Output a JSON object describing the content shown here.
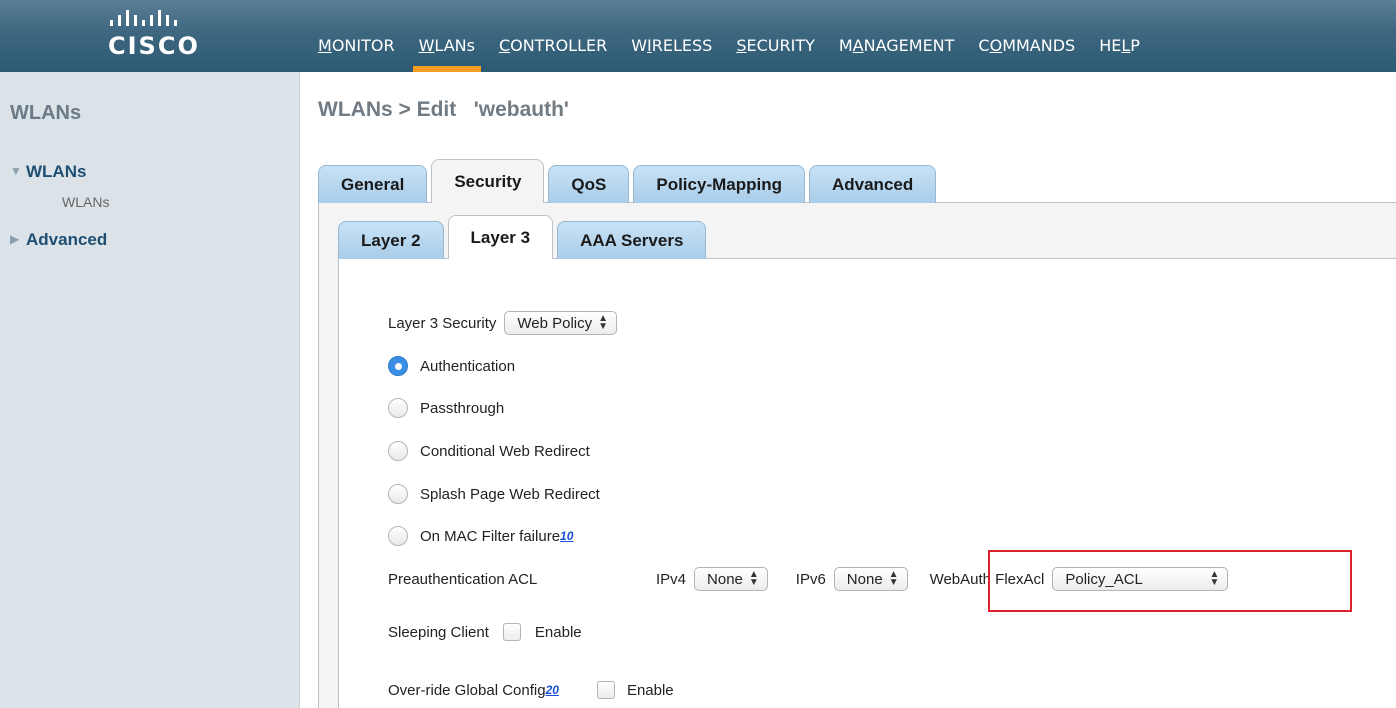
{
  "brand": {
    "logo_text": "CISCO"
  },
  "nav": [
    {
      "pre": "",
      "u": "M",
      "post": "ONITOR"
    },
    {
      "pre": "",
      "u": "W",
      "post": "LANs"
    },
    {
      "pre": "",
      "u": "C",
      "post": "ONTROLLER"
    },
    {
      "pre": "W",
      "u": "I",
      "post": "RELESS"
    },
    {
      "pre": "",
      "u": "S",
      "post": "ECURITY"
    },
    {
      "pre": "M",
      "u": "A",
      "post": "NAGEMENT"
    },
    {
      "pre": "C",
      "u": "O",
      "post": "MMANDS"
    },
    {
      "pre": "HE",
      "u": "L",
      "post": "P"
    }
  ],
  "sidebar": {
    "title": "WLANs",
    "items": [
      {
        "label": "WLANs",
        "sub": "WLANs"
      },
      {
        "label": "Advanced"
      }
    ]
  },
  "page": {
    "title": "WLANs > Edit   'webauth'"
  },
  "tabs": [
    "General",
    "Security",
    "QoS",
    "Policy-Mapping",
    "Advanced"
  ],
  "subtabs": [
    "Layer 2",
    "Layer 3",
    "AAA Servers"
  ],
  "form": {
    "layer3_security_label": "Layer 3 Security",
    "layer3_security_value": "Web Policy",
    "options": [
      "Authentication",
      "Passthrough",
      "Conditional Web Redirect",
      "Splash Page Web Redirect",
      "On MAC Filter failure"
    ],
    "mac_filter_footnote": "10",
    "preauth_label": "Preauthentication ACL",
    "ipv4_label": "IPv4",
    "ipv4_value": "None",
    "ipv6_label": "IPv6",
    "ipv6_value": "None",
    "flexacl_label": "WebAuth FlexAcl",
    "flexacl_value": "Policy_ACL",
    "sleeping_label": "Sleeping Client",
    "sleeping_enable": "Enable",
    "override_label": "Over-ride Global Config",
    "override_footnote": "20",
    "override_enable": "Enable"
  }
}
